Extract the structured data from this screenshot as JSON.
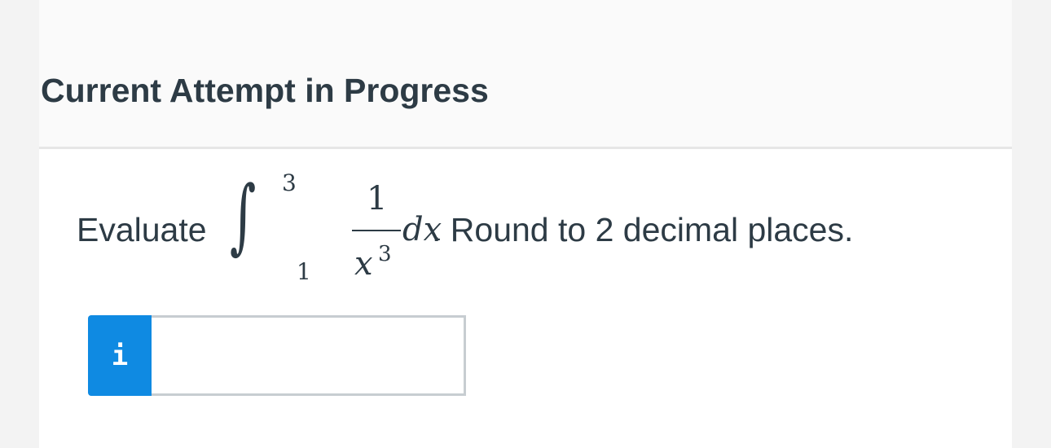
{
  "header": {
    "title": "Current Attempt in Progress"
  },
  "question": {
    "prefix": "Evaluate",
    "integral": {
      "sign": "∫",
      "upper_limit": "3",
      "lower_limit": "1",
      "numerator": "1",
      "denominator_base": "x",
      "denominator_exponent": "3",
      "differential": "dx"
    },
    "suffix": ". Round to 2 decimal places."
  },
  "answer": {
    "info_icon": "info-icon",
    "info_glyph": "i",
    "input_value": "",
    "input_placeholder": ""
  },
  "colors": {
    "accent": "#0f8ae2",
    "text": "#2d3b45",
    "header_background": "#fafafa",
    "divider": "#e6e6e6",
    "input_border": "#c7cdd1"
  }
}
